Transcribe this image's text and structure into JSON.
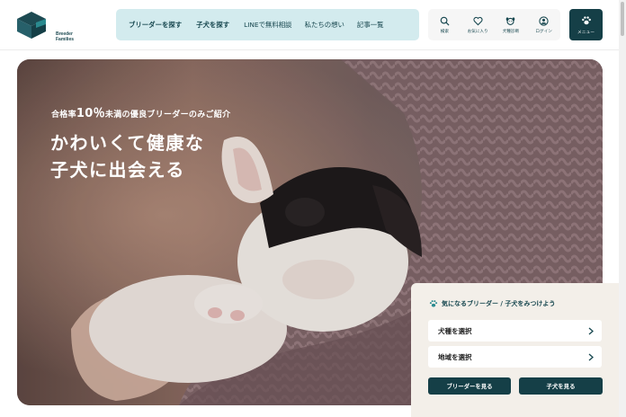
{
  "brand": {
    "logo_text_1": "Breeder",
    "logo_text_2": "Families"
  },
  "nav": {
    "items": [
      {
        "label": "ブリーダーを探す"
      },
      {
        "label": "子犬を探す"
      },
      {
        "label": "LINEで無料相談"
      },
      {
        "label": "私たちの想い"
      },
      {
        "label": "記事一覧"
      }
    ]
  },
  "utility": {
    "search": "検索",
    "favorites": "お気に入り",
    "diagnosis": "犬種診断",
    "login": "ログイン"
  },
  "menu": {
    "label": "メニュー"
  },
  "hero": {
    "subtitle_pre": "合格率",
    "subtitle_num": "10％",
    "subtitle_post": "未満の優良ブリーダーのみご紹介",
    "title_line1": "かわいくて健康な",
    "title_line2": "子犬に出会える"
  },
  "search_card": {
    "heading": "気になるブリーダー / 子犬をみつけよう",
    "breed_select": "犬種を選択",
    "region_select": "地域を選択",
    "breeder_button": "ブリーダーを見る",
    "puppy_button": "子犬を見る"
  },
  "colors": {
    "primary": "#153f47",
    "nav_bg": "#d3ebee",
    "card_bg": "#f3efe9"
  }
}
